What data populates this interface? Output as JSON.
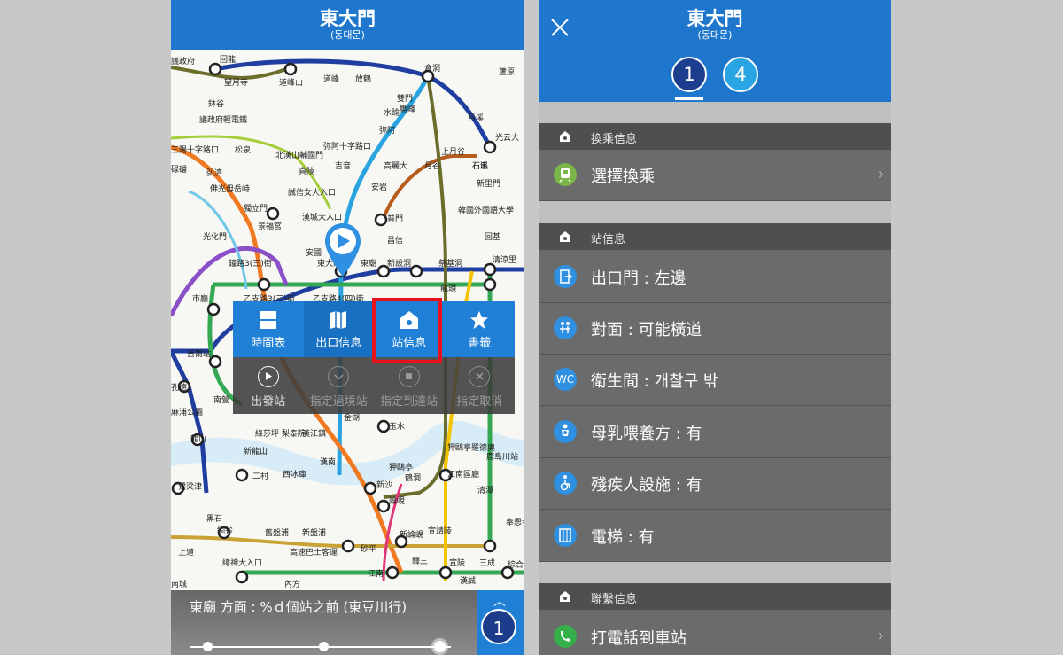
{
  "left_screen": {
    "header": {
      "title": "東大門",
      "subtitle": "(동대문)"
    },
    "map": {
      "stations": [
        {
          "name": "議政府"
        },
        {
          "name": "回龍"
        },
        {
          "name": "望月寺"
        },
        {
          "name": "道峰山"
        },
        {
          "name": "道峰"
        },
        {
          "name": "放鶴"
        },
        {
          "name": "倉洞"
        },
        {
          "name": "蘆原"
        },
        {
          "name": "鉢谷"
        },
        {
          "name": "議政府輕電鐵"
        },
        {
          "name": "雙門"
        },
        {
          "name": "鷹峰"
        },
        {
          "name": "水踰"
        },
        {
          "name": "月溪"
        },
        {
          "name": "弥阿"
        },
        {
          "name": "光云大"
        },
        {
          "name": "三陽十字路口"
        },
        {
          "name": "松泉"
        },
        {
          "name": "弥阿十字路口"
        },
        {
          "name": "北漢山輔國門"
        },
        {
          "name": "吉音"
        },
        {
          "name": "上月谷"
        },
        {
          "name": "石溪"
        },
        {
          "name": "新里門"
        },
        {
          "name": "碌磻"
        },
        {
          "name": "弘濟"
        },
        {
          "name": "貞陵"
        },
        {
          "name": "高麗大"
        },
        {
          "name": "月谷"
        },
        {
          "name": "石串"
        },
        {
          "name": "佛光"
        },
        {
          "name": "毋岳峙"
        },
        {
          "name": "誠信女大入口"
        },
        {
          "name": "安岩"
        },
        {
          "name": "獨立門"
        },
        {
          "name": "景福宮"
        },
        {
          "name": "漢城大入口"
        },
        {
          "name": "普門"
        },
        {
          "name": "韓國外國語大學"
        },
        {
          "name": "光化門"
        },
        {
          "name": "安國"
        },
        {
          "name": "昌信"
        },
        {
          "name": "回基"
        },
        {
          "name": "鐘路3(三)街"
        },
        {
          "name": "東大門"
        },
        {
          "name": "東廟"
        },
        {
          "name": "新設洞"
        },
        {
          "name": "祭基洞"
        },
        {
          "name": "清涼里"
        },
        {
          "name": "市廳"
        },
        {
          "name": "乙支路3(三)街"
        },
        {
          "name": "乙支路4(四)街"
        },
        {
          "name": "龍頭"
        },
        {
          "name": "孔德"
        },
        {
          "name": "首爾站"
        },
        {
          "name": "南營"
        },
        {
          "name": "麻浦公園"
        },
        {
          "name": "龍山"
        },
        {
          "name": "金湖"
        },
        {
          "name": "玉水"
        },
        {
          "name": "綠莎坪 梨泰院"
        },
        {
          "name": "漢江鎮"
        },
        {
          "name": "狎鷗亭羅德奧"
        },
        {
          "name": "新龍山"
        },
        {
          "name": "漢南"
        },
        {
          "name": "狎鷗亭"
        },
        {
          "name": "鹿島川站"
        },
        {
          "name": "二村"
        },
        {
          "name": "西冰庫"
        },
        {
          "name": "江南區廳"
        },
        {
          "name": "鷺梁津"
        },
        {
          "name": "新沙"
        },
        {
          "name": "鶴洞"
        },
        {
          "name": "清潭"
        },
        {
          "name": "論峴"
        },
        {
          "name": "黑石"
        },
        {
          "name": "銅雀"
        },
        {
          "name": "舊盤浦"
        },
        {
          "name": "新盤浦"
        },
        {
          "name": "新論峴"
        },
        {
          "name": "宣靖陵"
        },
        {
          "name": "奉恩寺"
        },
        {
          "name": "上道"
        },
        {
          "name": "總神大入口"
        },
        {
          "name": "高速巴士客運"
        },
        {
          "name": "砂平"
        },
        {
          "name": "驛三"
        },
        {
          "name": "宣陵"
        },
        {
          "name": "三成"
        },
        {
          "name": "綜合"
        },
        {
          "name": "南城"
        },
        {
          "name": "內方"
        },
        {
          "name": "江南"
        },
        {
          "name": "漢誠"
        }
      ],
      "line_colors": {
        "line1": "#1f3ea0",
        "line2": "#34a853",
        "line3": "#f07a22",
        "line4": "#2aa4e0",
        "line5": "#8b4fc7",
        "line6": "#b85c1e",
        "line7": "#6b6d2a",
        "line8": "#e0367a",
        "line9": "#c9a336",
        "airport": "#6fc7e8",
        "gyeongui": "#7fbfa7",
        "bundang": "#f5c400",
        "uijeongbu": "#ffa500"
      }
    },
    "context_menu": {
      "top_items": [
        {
          "label": "時間表",
          "icon": "timetable-icon"
        },
        {
          "label": "出口信息",
          "icon": "map-icon"
        },
        {
          "label": "站信息",
          "icon": "station-home-icon"
        },
        {
          "label": "書籤",
          "icon": "star-icon"
        }
      ],
      "bottom_items": [
        {
          "label": "出發站",
          "icon": "play-icon"
        },
        {
          "label": "指定過境站",
          "icon": "check-icon"
        },
        {
          "label": "指定到達站",
          "icon": "stop-icon"
        },
        {
          "label": "指定取消",
          "icon": "cancel-icon"
        }
      ]
    },
    "bottom_bar": {
      "text": "東廟 方面 : %ｄ個站之前 (東豆川行)",
      "line_badge": "1"
    }
  },
  "right_screen": {
    "header": {
      "title": "東大門",
      "subtitle": "(동대문)"
    },
    "line_tabs": [
      "1",
      "4"
    ],
    "colors": {
      "line1": "#1d3e8f",
      "line4": "#2aa5e3",
      "header": "#1e77cc"
    },
    "sections": {
      "transfer": {
        "title": "換乘信息",
        "row": "選擇換乘"
      },
      "station": {
        "title": "站信息",
        "rows": [
          {
            "icon": "exit-door-icon",
            "label": "出口門 : 左邊"
          },
          {
            "icon": "opposite-icon",
            "label": "對面 : 可能橫道"
          },
          {
            "icon": "wc-icon",
            "icon_text": "WC",
            "label": "衛生間 : 개찰구 밖"
          },
          {
            "icon": "nursing-room-icon",
            "label": "母乳喂養方 : 有"
          },
          {
            "icon": "wheelchair-icon",
            "label": "殘疾人設施 : 有"
          },
          {
            "icon": "elevator-icon",
            "label": "電梯 : 有"
          }
        ]
      },
      "contact": {
        "title": "聯繫信息",
        "row": "打電話到車站"
      }
    }
  }
}
